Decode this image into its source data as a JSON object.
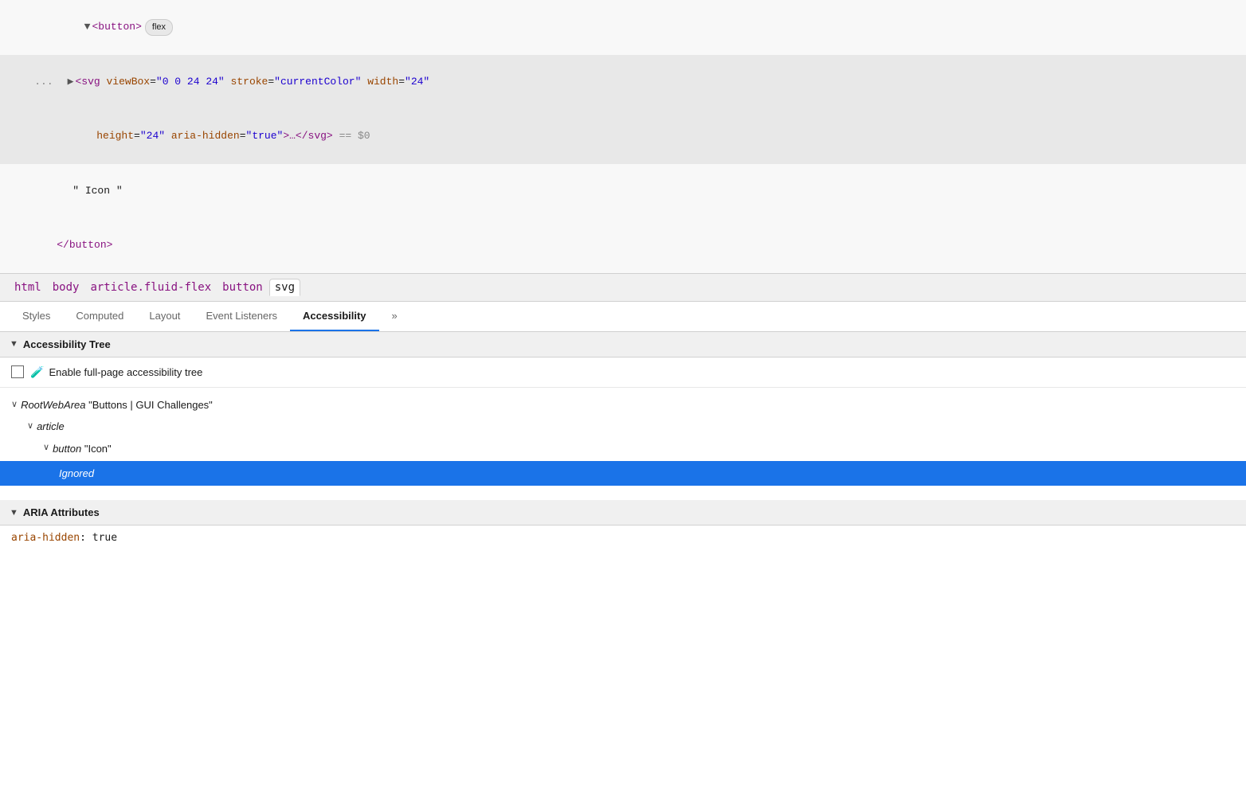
{
  "source": {
    "lines": [
      {
        "id": "line1",
        "indent": "        ",
        "content_type": "tag_open_with_arrow",
        "arrow": "▼",
        "tag": "<button>",
        "badge": "flex",
        "highlighted": false
      },
      {
        "id": "line2",
        "indent": "          ",
        "content_type": "svg_open",
        "dots": "...",
        "arrow": "▶",
        "svg_text": "<svg viewBox=\"0 0 24 24\" stroke=\"currentColor\" width=\"24\"",
        "highlighted": true
      },
      {
        "id": "line3",
        "indent": "              ",
        "content_type": "svg_attrs",
        "text": "height=\"24\" aria-hidden=\"true\">…</svg>",
        "dollar_zero": "== $0",
        "highlighted": true
      },
      {
        "id": "line4",
        "indent": "          ",
        "content_type": "text_node",
        "text": "\" Icon \"",
        "highlighted": false
      },
      {
        "id": "line5",
        "indent": "        ",
        "content_type": "tag_close",
        "tag": "</button>",
        "highlighted": false
      }
    ]
  },
  "breadcrumb": {
    "items": [
      {
        "label": "html",
        "active": false
      },
      {
        "label": "body",
        "active": false
      },
      {
        "label": "article.fluid-flex",
        "active": false
      },
      {
        "label": "button",
        "active": false
      },
      {
        "label": "svg",
        "active": true
      }
    ]
  },
  "tabs": {
    "items": [
      {
        "label": "Styles",
        "active": false
      },
      {
        "label": "Computed",
        "active": false
      },
      {
        "label": "Layout",
        "active": false
      },
      {
        "label": "Event Listeners",
        "active": false
      },
      {
        "label": "Accessibility",
        "active": true
      },
      {
        "label": "»",
        "active": false
      }
    ]
  },
  "accessibility": {
    "tree_section_label": "Accessibility Tree",
    "checkbox_label": "Enable full-page accessibility tree",
    "tree": {
      "root": {
        "type": "RootWebArea",
        "label": "\"Buttons | GUI Challenges\""
      },
      "article": {
        "type": "article"
      },
      "button": {
        "type": "button",
        "label": "\"Icon\""
      },
      "ignored": {
        "label": "Ignored"
      }
    },
    "aria_section_label": "ARIA Attributes",
    "aria_attrs": [
      {
        "name": "aria-hidden",
        "value": "true"
      }
    ]
  },
  "colors": {
    "active_tab_underline": "#1a73e8",
    "selected_row_bg": "#1a73e8",
    "tag_purple": "#881280",
    "attr_orange": "#994500",
    "string_blue": "#1c00cf"
  }
}
